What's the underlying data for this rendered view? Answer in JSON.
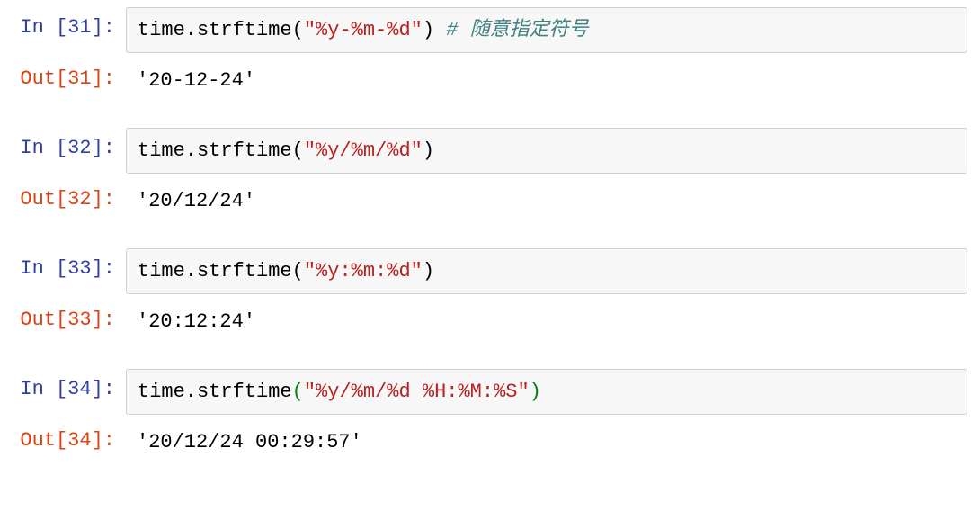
{
  "cells": [
    {
      "in_label": "In [31]:",
      "out_label": "Out[31]:",
      "code": {
        "call": "time.strftime",
        "paren_open": "(",
        "string": "\"%y-%m-%d\"",
        "paren_close": ")",
        "comment": " # 随意指定符号"
      },
      "output": "'20-12-24'"
    },
    {
      "in_label": "In [32]:",
      "out_label": "Out[32]:",
      "code": {
        "call": "time.strftime",
        "paren_open": "(",
        "string": "\"%y/%m/%d\"",
        "paren_close": ")",
        "comment": ""
      },
      "output": "'20/12/24'"
    },
    {
      "in_label": "In [33]:",
      "out_label": "Out[33]:",
      "code": {
        "call": "time.strftime",
        "paren_open": "(",
        "string": "\"%y:%m:%d\"",
        "paren_close": ")",
        "comment": ""
      },
      "output": "'20:12:24'"
    },
    {
      "in_label": "In [34]:",
      "out_label": "Out[34]:",
      "code": {
        "call": "time.strftime",
        "paren_open": "(",
        "string": "\"%y/%m/%d %H:%M:%S\"",
        "paren_close": ")",
        "comment": ""
      },
      "green_paren": true,
      "output": "'20/12/24 00:29:57'"
    }
  ]
}
